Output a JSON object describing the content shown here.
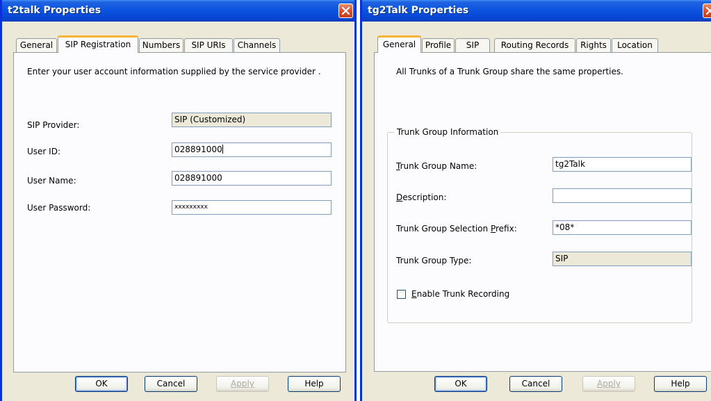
{
  "left_dialog": {
    "title": "t2talk Properties",
    "tabs": [
      "General",
      "SIP Registration",
      "Numbers",
      "SIP URIs",
      "Channels"
    ],
    "active_tab": "SIP Registration",
    "instruction": "Enter your user account information supplied by the service provider .",
    "fields": [
      {
        "label": "SIP Provider:",
        "value": "SIP (Customized)",
        "readonly": true
      },
      {
        "label": "User ID:",
        "value": "028891000"
      },
      {
        "label": "User Name:",
        "value": "028891000"
      },
      {
        "label": "User Password:",
        "value": "xxxxxxxxx"
      }
    ],
    "buttons": {
      "ok": "OK",
      "cancel": "Cancel",
      "apply": "Apply",
      "help": "Help"
    }
  },
  "right_dialog": {
    "title": "tg2Talk Properties",
    "tabs": [
      "General",
      "Profile",
      "SIP",
      "Routing Records",
      "Rights",
      "Location"
    ],
    "active_tab": "General",
    "info": "All Trunks of a Trunk Group share the same properties.",
    "group_title": "Trunk Group Information",
    "fields": [
      {
        "label_first": "T",
        "label_rest": "runk Group Name:",
        "value": "tg2Talk"
      },
      {
        "label_first": "D",
        "label_rest": "escription:",
        "value": ""
      },
      {
        "label_pre": "Trunk Group Selection ",
        "label_u": "P",
        "label_post": "refix:",
        "value": "*08*"
      },
      {
        "label": "Trunk Group Type:",
        "value": "SIP",
        "readonly": true
      }
    ],
    "checkbox": {
      "label_first": "E",
      "label_rest": "nable Trunk Recording",
      "checked": false
    },
    "buttons": {
      "ok": "OK",
      "cancel": "Cancel",
      "apply": "Apply",
      "help": "Help"
    }
  }
}
